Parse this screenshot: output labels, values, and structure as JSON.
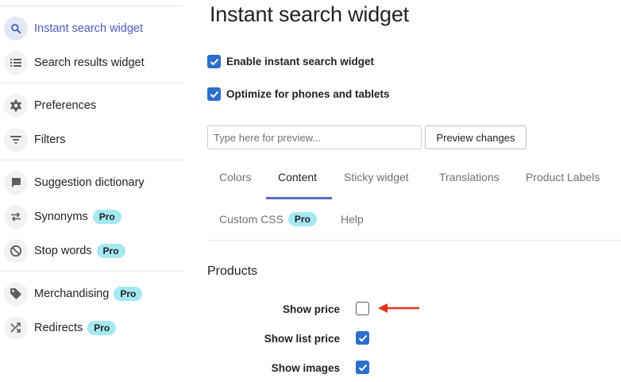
{
  "sidebar": {
    "items": [
      {
        "label": "Instant search widget",
        "icon": "search-icon",
        "active": true
      },
      {
        "label": "Search results widget",
        "icon": "list-icon"
      },
      {
        "label": "Preferences",
        "icon": "gear-icon"
      },
      {
        "label": "Filters",
        "icon": "filter-icon"
      },
      {
        "label": "Suggestion dictionary",
        "icon": "chat-bubble-icon"
      },
      {
        "label": "Synonyms",
        "icon": "swap-arrows-icon",
        "badge": "Pro"
      },
      {
        "label": "Stop words",
        "icon": "block-icon",
        "badge": "Pro"
      },
      {
        "label": "Merchandising",
        "icon": "tag-icon",
        "badge": "Pro"
      },
      {
        "label": "Redirects",
        "icon": "shuffle-icon",
        "badge": "Pro"
      }
    ]
  },
  "main": {
    "title": "Instant search widget",
    "options": [
      {
        "label": "Enable instant search widget",
        "checked": true
      },
      {
        "label": "Optimize for phones and tablets",
        "checked": true
      }
    ],
    "preview": {
      "placeholder": "Type here for preview...",
      "button_label": "Preview changes"
    },
    "tabs": [
      {
        "label": "Colors"
      },
      {
        "label": "Content",
        "active": true
      },
      {
        "label": "Sticky widget"
      },
      {
        "label": "Translations"
      },
      {
        "label": "Product Labels"
      },
      {
        "label": "Custom CSS",
        "badge": "Pro"
      },
      {
        "label": "Help"
      }
    ],
    "products": {
      "title": "Products",
      "fields": [
        {
          "label": "Show price",
          "checked": false
        },
        {
          "label": "Show list price",
          "checked": true
        },
        {
          "label": "Show images",
          "checked": true
        }
      ]
    }
  },
  "colors": {
    "accent": "#2c6ecb",
    "active_nav": "#4a5bbd",
    "tab_underline": "#5c6ac4",
    "pro_badge": "#a4e8f2",
    "annotation_arrow": "#e8331b"
  }
}
